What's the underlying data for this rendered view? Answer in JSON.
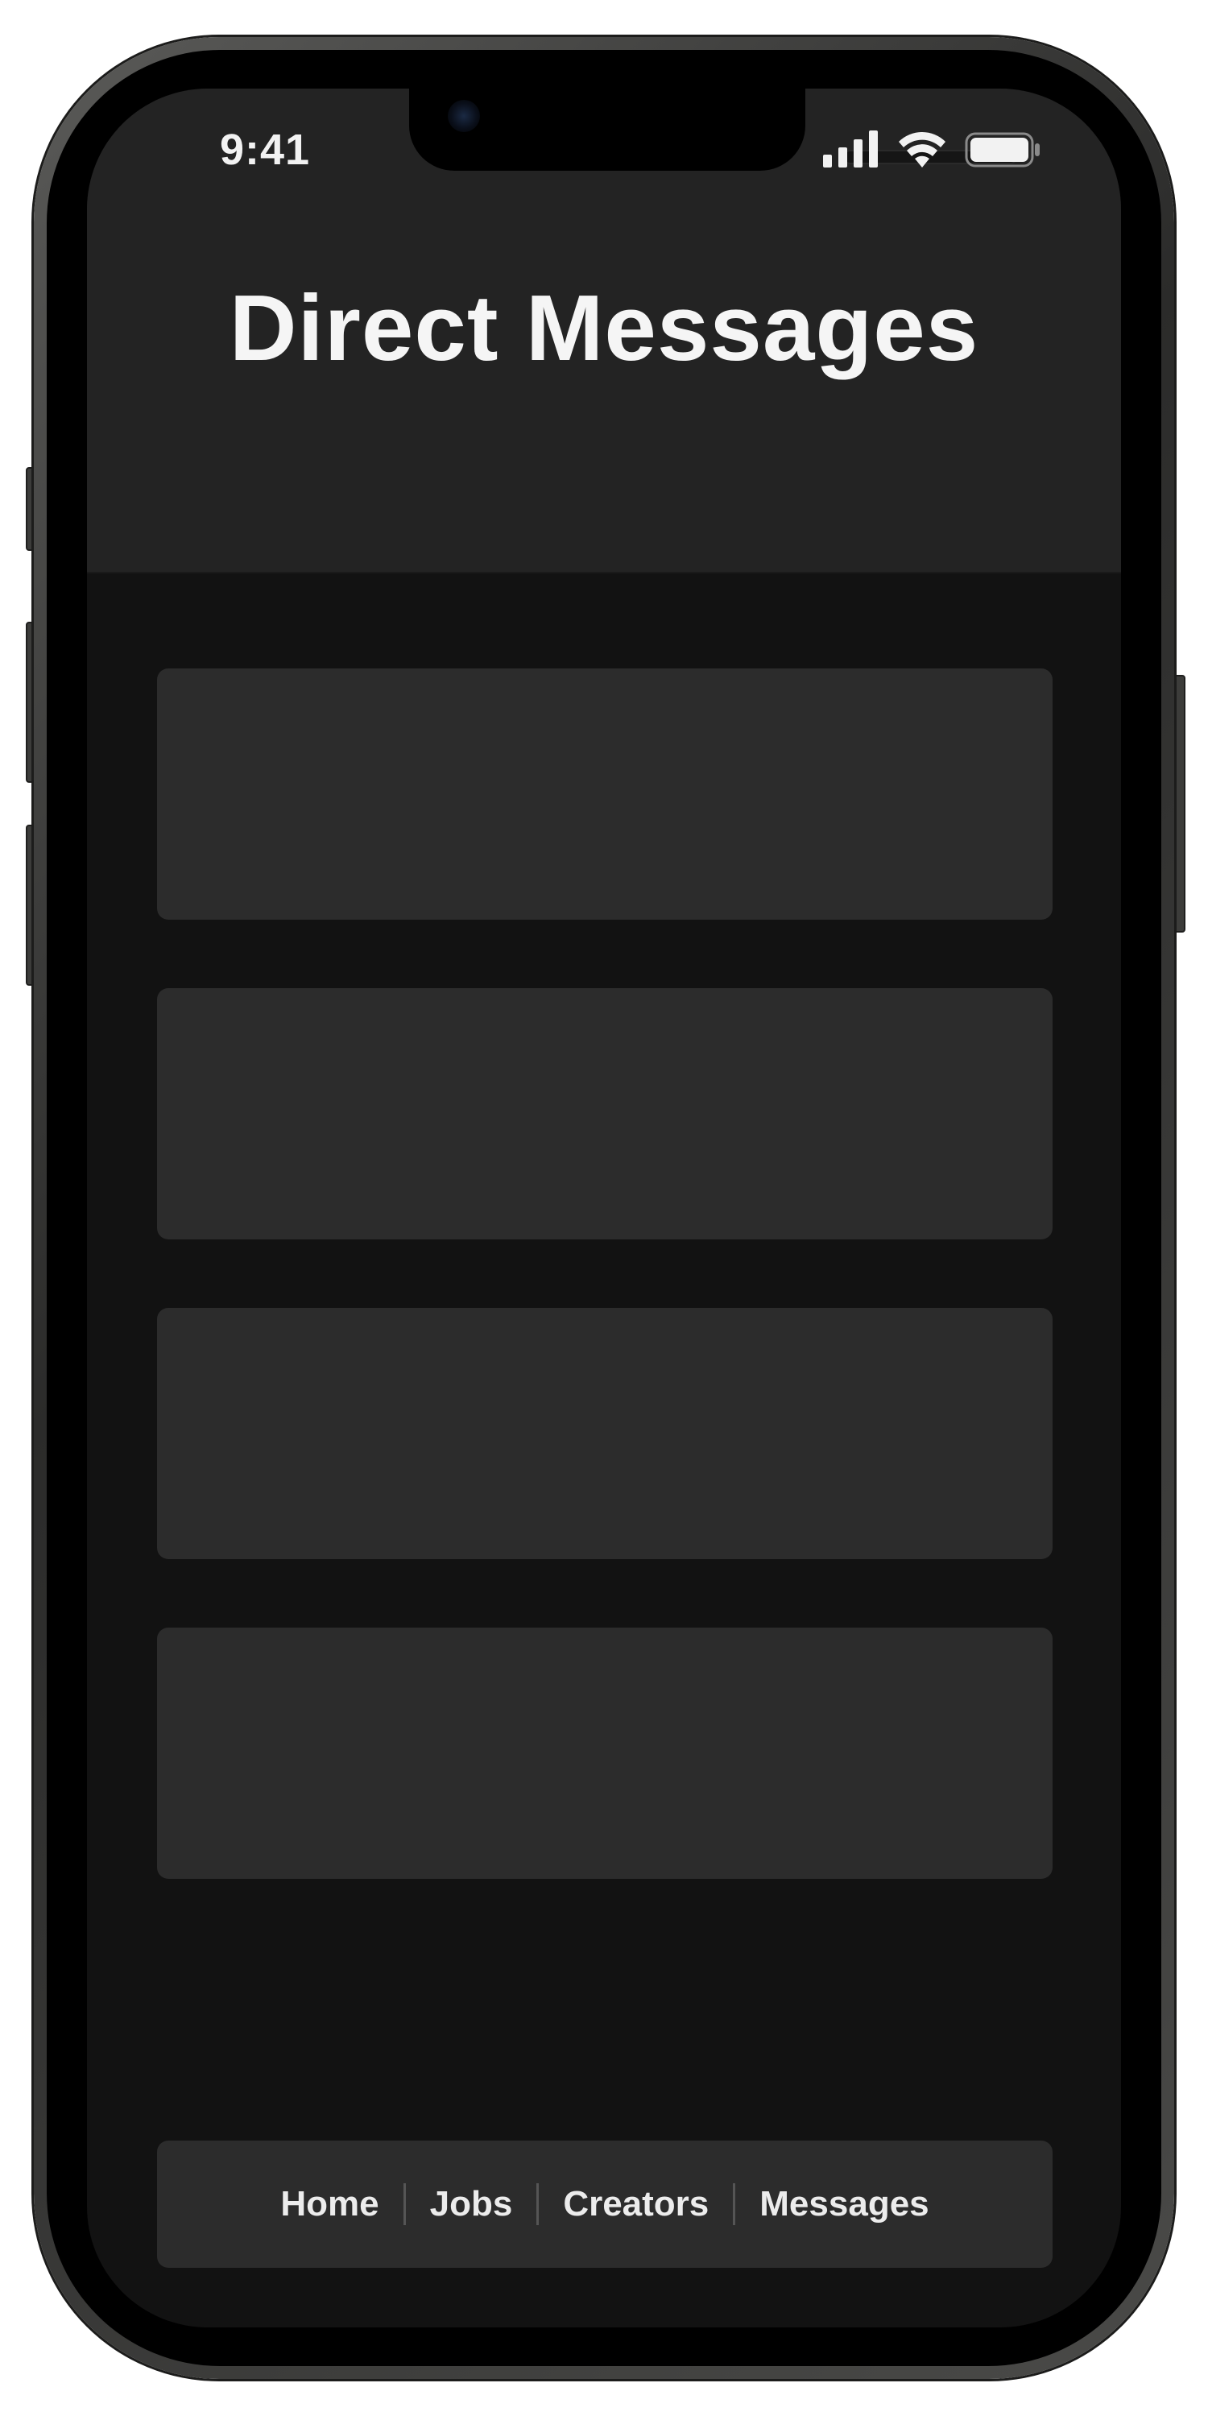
{
  "status_bar": {
    "time": "9:41"
  },
  "header": {
    "title": "Direct Messages"
  },
  "messages": {
    "items": [
      {},
      {},
      {},
      {}
    ]
  },
  "nav": {
    "items": [
      {
        "label": "Home"
      },
      {
        "label": "Jobs"
      },
      {
        "label": "Creators"
      },
      {
        "label": "Messages"
      }
    ]
  },
  "colors": {
    "header_bg": "#232323",
    "screen_bg": "#121212",
    "card_bg": "#2c2c2c",
    "text": "#f5f5f5"
  },
  "icons": {
    "signal": "cellular-signal-icon",
    "wifi": "wifi-icon",
    "battery": "battery-icon"
  }
}
